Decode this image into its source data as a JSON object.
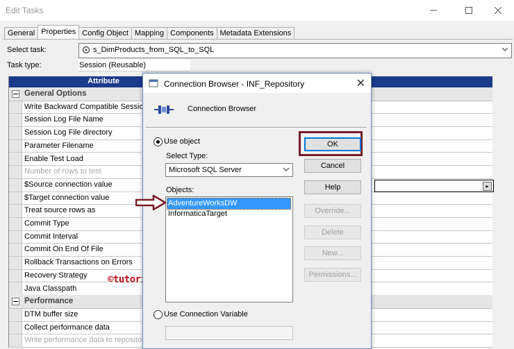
{
  "window": {
    "title": "Edit Tasks"
  },
  "tabs": [
    "General",
    "Properties",
    "Config Object",
    "Mapping",
    "Components",
    "Metadata Extensions"
  ],
  "active_tab": "Properties",
  "select_task": {
    "label": "Select task:",
    "value": "s_DimProducts_from_SQL_to_SQL"
  },
  "task_type": {
    "label": "Task type:",
    "value": "Session (Reusable)"
  },
  "grid": {
    "header": "Attribute",
    "rows": [
      {
        "label": "General Options",
        "group": true
      },
      {
        "label": "Write Backward Compatible Session Lo"
      },
      {
        "label": "Session Log File Name"
      },
      {
        "label": "Session Log File directory"
      },
      {
        "label": "Parameter Filename"
      },
      {
        "label": "Enable Test Load"
      },
      {
        "label": "Number of rows to test",
        "disabled": true
      },
      {
        "label": "$Source connection value"
      },
      {
        "label": "$Target connection value"
      },
      {
        "label": "Treat source rows as"
      },
      {
        "label": "Commit Type"
      },
      {
        "label": "Commit Interval"
      },
      {
        "label": "Commit On End Of File"
      },
      {
        "label": "Rollback Transactions on Errors"
      },
      {
        "label": "Recovery Strategy"
      },
      {
        "label": "Java Classpath"
      },
      {
        "label": "Performance",
        "group": true
      },
      {
        "label": "DTM buffer size"
      },
      {
        "label": "Collect performance data"
      },
      {
        "label": "Write performance data to repository",
        "disabled": true
      }
    ]
  },
  "watermark": "©tutorialgateway.org",
  "dialog": {
    "title": "Connection Browser - INF_Repository",
    "header_text": "Connection Browser",
    "use_object_label": "Use object",
    "select_type_label": "Select Type:",
    "select_type_value": "Microsoft SQL Server",
    "objects_label": "Objects:",
    "objects": [
      "AdventureWorksDW",
      "InformaticaTarget"
    ],
    "selected_object": "AdventureWorksDW",
    "use_variable_label": "Use Connection Variable",
    "buttons": {
      "ok": "OK",
      "cancel": "Cancel",
      "help": "Help",
      "override": "Override...",
      "delete": "Delete",
      "new": "New...",
      "permissions": "Permissions..."
    }
  },
  "colors": {
    "grid_header": "#1b3a8a",
    "selection": "#3399ff",
    "highlight": "#7a1b2a",
    "watermark": "#b5121b"
  }
}
